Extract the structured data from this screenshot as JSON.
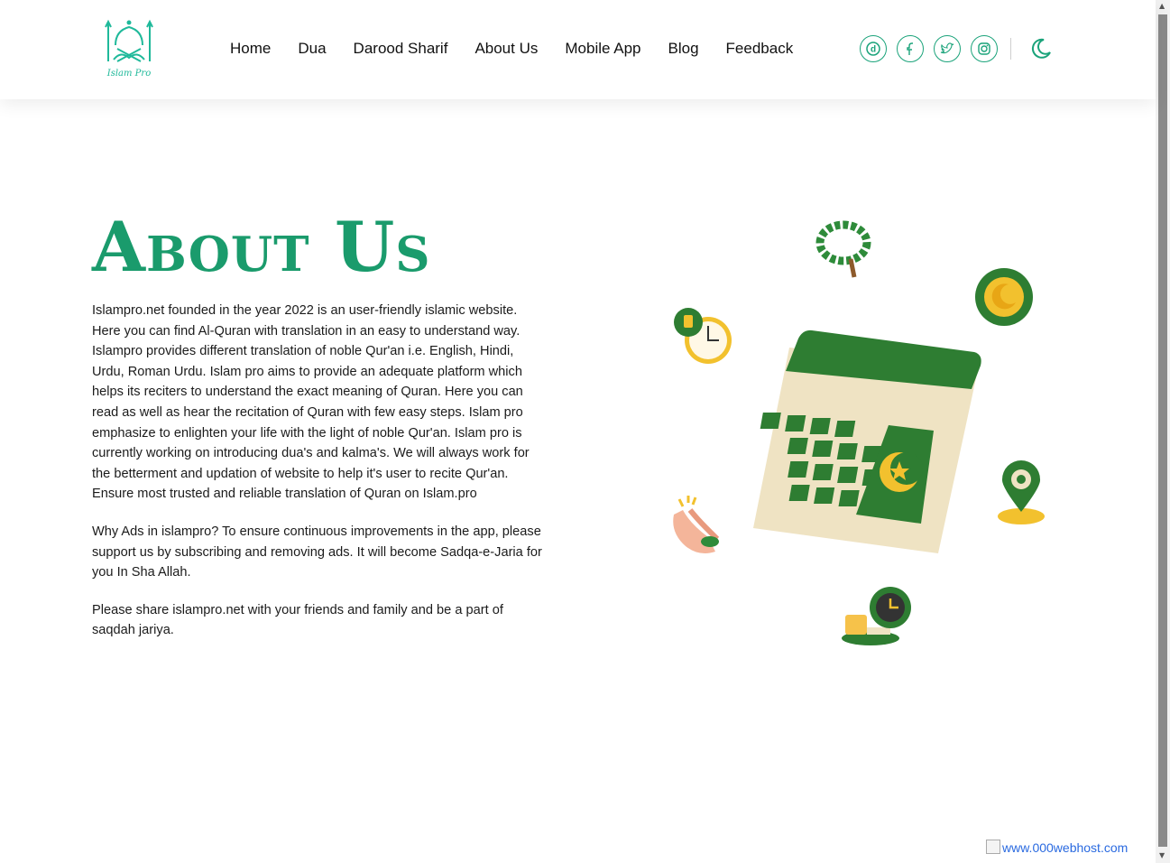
{
  "header": {
    "logo_text": "Islam Pro",
    "nav": [
      "Home",
      "Dua",
      "Darood Sharif",
      "About Us",
      "Mobile App",
      "Blog",
      "Feedback"
    ],
    "social": [
      "dailymotion-icon",
      "facebook-icon",
      "twitter-icon",
      "instagram-icon"
    ],
    "theme_toggle_icon": "moon-icon"
  },
  "main": {
    "title": "About Us",
    "paragraphs": [
      "Islampro.net founded in the year 2022 is an user-friendly islamic website. Here you can find Al-Quran with translation in an easy to understand way. Islampro provides different translation of noble Qur'an i.e. English, Hindi, Urdu, Roman Urdu. Islam pro aims to provide an adequate platform which helps its reciters to understand the exact meaning of Quran. Here you can read as well as hear the recitation of Quran with few easy steps. Islam pro emphasize to enlighten your life with the light of noble Qur'an. Islam pro is currently working on introducing dua's and kalma's. We will always work for the betterment and updation of website to help it's user to recite Qur'an. Ensure most trusted and reliable translation of Quran on Islam.pro",
      "Why Ads in islampro? To ensure continuous improvements in the app, please support us by subscribing and removing ads. It will become Sadqa-e-Jaria for you In Sha Allah.",
      "Please share islampro.net with your friends and family and be a part of saqdah jariya."
    ]
  },
  "footer": {
    "host_link": "www.000webhost.com"
  },
  "colors": {
    "brand_green": "#1a9b6c",
    "logo_teal": "#1fb99a",
    "icon_green": "#1aa37a",
    "calendar_green": "#2e7d32",
    "cream": "#efe3c3",
    "gold": "#f2c12e"
  }
}
